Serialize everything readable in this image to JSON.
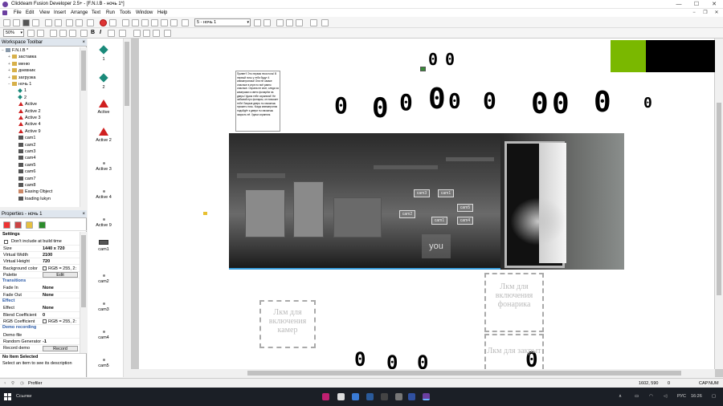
{
  "window": {
    "title": "Clickteam Fusion Developer 2.5+ - [F.N.I.B - ночь 1*]",
    "minimize": "—",
    "maximize": "☐",
    "close": "✕"
  },
  "menu": [
    "File",
    "Edit",
    "View",
    "Insert",
    "Arrange",
    "Text",
    "Run",
    "Tools",
    "Window",
    "Help"
  ],
  "menu_right": [
    "−",
    "❐",
    "✕"
  ],
  "toolbar": {
    "zoom": "50%",
    "frame_selector": "5 - ночь 1",
    "bold": "B",
    "italic": "I"
  },
  "workspace": {
    "title": "Workspace Toolbar",
    "close": "×",
    "tree": [
      {
        "label": "F.N.I.B *",
        "level": 0,
        "icon": "app",
        "exp": "−"
      },
      {
        "label": "заставка",
        "level": 1,
        "icon": "folder",
        "exp": "+"
      },
      {
        "label": "меню",
        "level": 1,
        "icon": "folder",
        "exp": "+"
      },
      {
        "label": "дневник",
        "level": 1,
        "icon": "folder",
        "exp": "+"
      },
      {
        "label": "загрузка",
        "level": 1,
        "icon": "folder",
        "exp": "+"
      },
      {
        "label": "ночь 1",
        "level": 1,
        "icon": "folder",
        "exp": "−"
      },
      {
        "label": "1",
        "level": 2,
        "icon": "dia",
        "exp": ""
      },
      {
        "label": "2",
        "level": 2,
        "icon": "dia",
        "exp": ""
      },
      {
        "label": "Active",
        "level": 2,
        "icon": "tri",
        "exp": ""
      },
      {
        "label": "Active 2",
        "level": 2,
        "icon": "tri",
        "exp": ""
      },
      {
        "label": "Active 3",
        "level": 2,
        "icon": "tri",
        "exp": ""
      },
      {
        "label": "Active 4",
        "level": 2,
        "icon": "tri",
        "exp": ""
      },
      {
        "label": "Active 9",
        "level": 2,
        "icon": "tri",
        "exp": ""
      },
      {
        "label": "cam1",
        "level": 2,
        "icon": "cam",
        "exp": ""
      },
      {
        "label": "cam2",
        "level": 2,
        "icon": "cam",
        "exp": ""
      },
      {
        "label": "cam3",
        "level": 2,
        "icon": "cam",
        "exp": ""
      },
      {
        "label": "cam4",
        "level": 2,
        "icon": "cam",
        "exp": ""
      },
      {
        "label": "cam5",
        "level": 2,
        "icon": "cam",
        "exp": ""
      },
      {
        "label": "cam6",
        "level": 2,
        "icon": "cam",
        "exp": ""
      },
      {
        "label": "cam7",
        "level": 2,
        "icon": "cam",
        "exp": ""
      },
      {
        "label": "cam8",
        "level": 2,
        "icon": "cam",
        "exp": ""
      },
      {
        "label": "Easing Object",
        "level": 2,
        "icon": "ease",
        "exp": ""
      },
      {
        "label": "loading lukyn",
        "level": 2,
        "icon": "cam",
        "exp": ""
      }
    ]
  },
  "properties": {
    "title": "Properties - ночь 1",
    "close": "×",
    "rows": [
      {
        "kind": "cat",
        "label": "Settings",
        "black": true
      },
      {
        "kind": "check",
        "label": "Don't include at build time"
      },
      {
        "kind": "kv",
        "label": "Size",
        "value": "1440 x 720"
      },
      {
        "kind": "kv",
        "label": "Virtual Width",
        "value": "2100"
      },
      {
        "kind": "kv",
        "label": "Virtual Height",
        "value": "720"
      },
      {
        "kind": "color",
        "label": "Background color",
        "value": "RGB = 255, 2:"
      },
      {
        "kind": "btn",
        "label": "Palette",
        "value": "Edit"
      },
      {
        "kind": "cat",
        "label": "Transitions"
      },
      {
        "kind": "kv",
        "label": "Fade In",
        "value": "None"
      },
      {
        "kind": "kv",
        "label": "Fade Out",
        "value": "None"
      },
      {
        "kind": "cat",
        "label": "Effect"
      },
      {
        "kind": "kv",
        "label": "Effect",
        "value": "None"
      },
      {
        "kind": "kv",
        "label": "Blend Coefficient",
        "value": "0"
      },
      {
        "kind": "color",
        "label": "RGB Coefficient",
        "value": "RGB = 255, 2:"
      },
      {
        "kind": "cat",
        "label": "Demo recording"
      },
      {
        "kind": "kv",
        "label": "Demo file",
        "value": ""
      },
      {
        "kind": "kv",
        "label": "Random Generator",
        "value": "-1"
      },
      {
        "kind": "btn",
        "label": "Record demo",
        "value": "Record"
      }
    ]
  },
  "status_info": {
    "title": "No Item Selected",
    "desc": "Select an item to see its description"
  },
  "bottom_tabs": {
    "profiler": "Profiler"
  },
  "layer_objects": [
    {
      "label": "1",
      "icon": "dia"
    },
    {
      "label": "2",
      "icon": "dia"
    },
    {
      "label": "Active",
      "icon": "tri"
    },
    {
      "label": "Active 2",
      "icon": "tri"
    },
    {
      "label": "Active 3",
      "icon": "dot"
    },
    {
      "label": "Active 4",
      "icon": "dot"
    },
    {
      "label": "Active 9",
      "icon": "dot"
    },
    {
      "label": "cam1",
      "icon": "cam"
    },
    {
      "label": "cam2",
      "icon": "dot"
    },
    {
      "label": "cam3",
      "icon": "dot"
    },
    {
      "label": "cam4",
      "icon": "dot"
    },
    {
      "label": "cam5",
      "icon": "dot"
    }
  ],
  "stage": {
    "zero_digit": "0",
    "cam_labels": [
      "cam3",
      "cam1",
      "cam2",
      "cam1",
      "cam4",
      "cam5"
    ],
    "you_label": "you",
    "note_text": "Привет!! Это первая твоя ночь! В первый ночь у тебя будут 4 аниматроника! Они не самые опасные в игре но всё равно опасные. Охрана не спит, следи за камерами и свети фонарём на дверь! Удачи тебе охранник!! Не забывай про фонарик, он поможет тебе! Закрыв дверь ты сможешь прожить ночь. Когда аниматроник подойдёт к двери ты сможешь закрыть её. Удачи охранник.",
    "box_left": "Лкм для включения камер",
    "box_right_top": "Лкм для включения фонарика",
    "box_right_bottom": "Лкм для закрыт"
  },
  "statusbar": {
    "coords": "1602, 590",
    "zoom": "0",
    "cap": "CAP",
    "num": "NUM"
  },
  "taskbar": {
    "search": "Ссылки",
    "lang": "РУС",
    "time": "16:26"
  },
  "colors": {
    "accent_green": "#7ab800",
    "cam_border": "#3aa0e0"
  }
}
